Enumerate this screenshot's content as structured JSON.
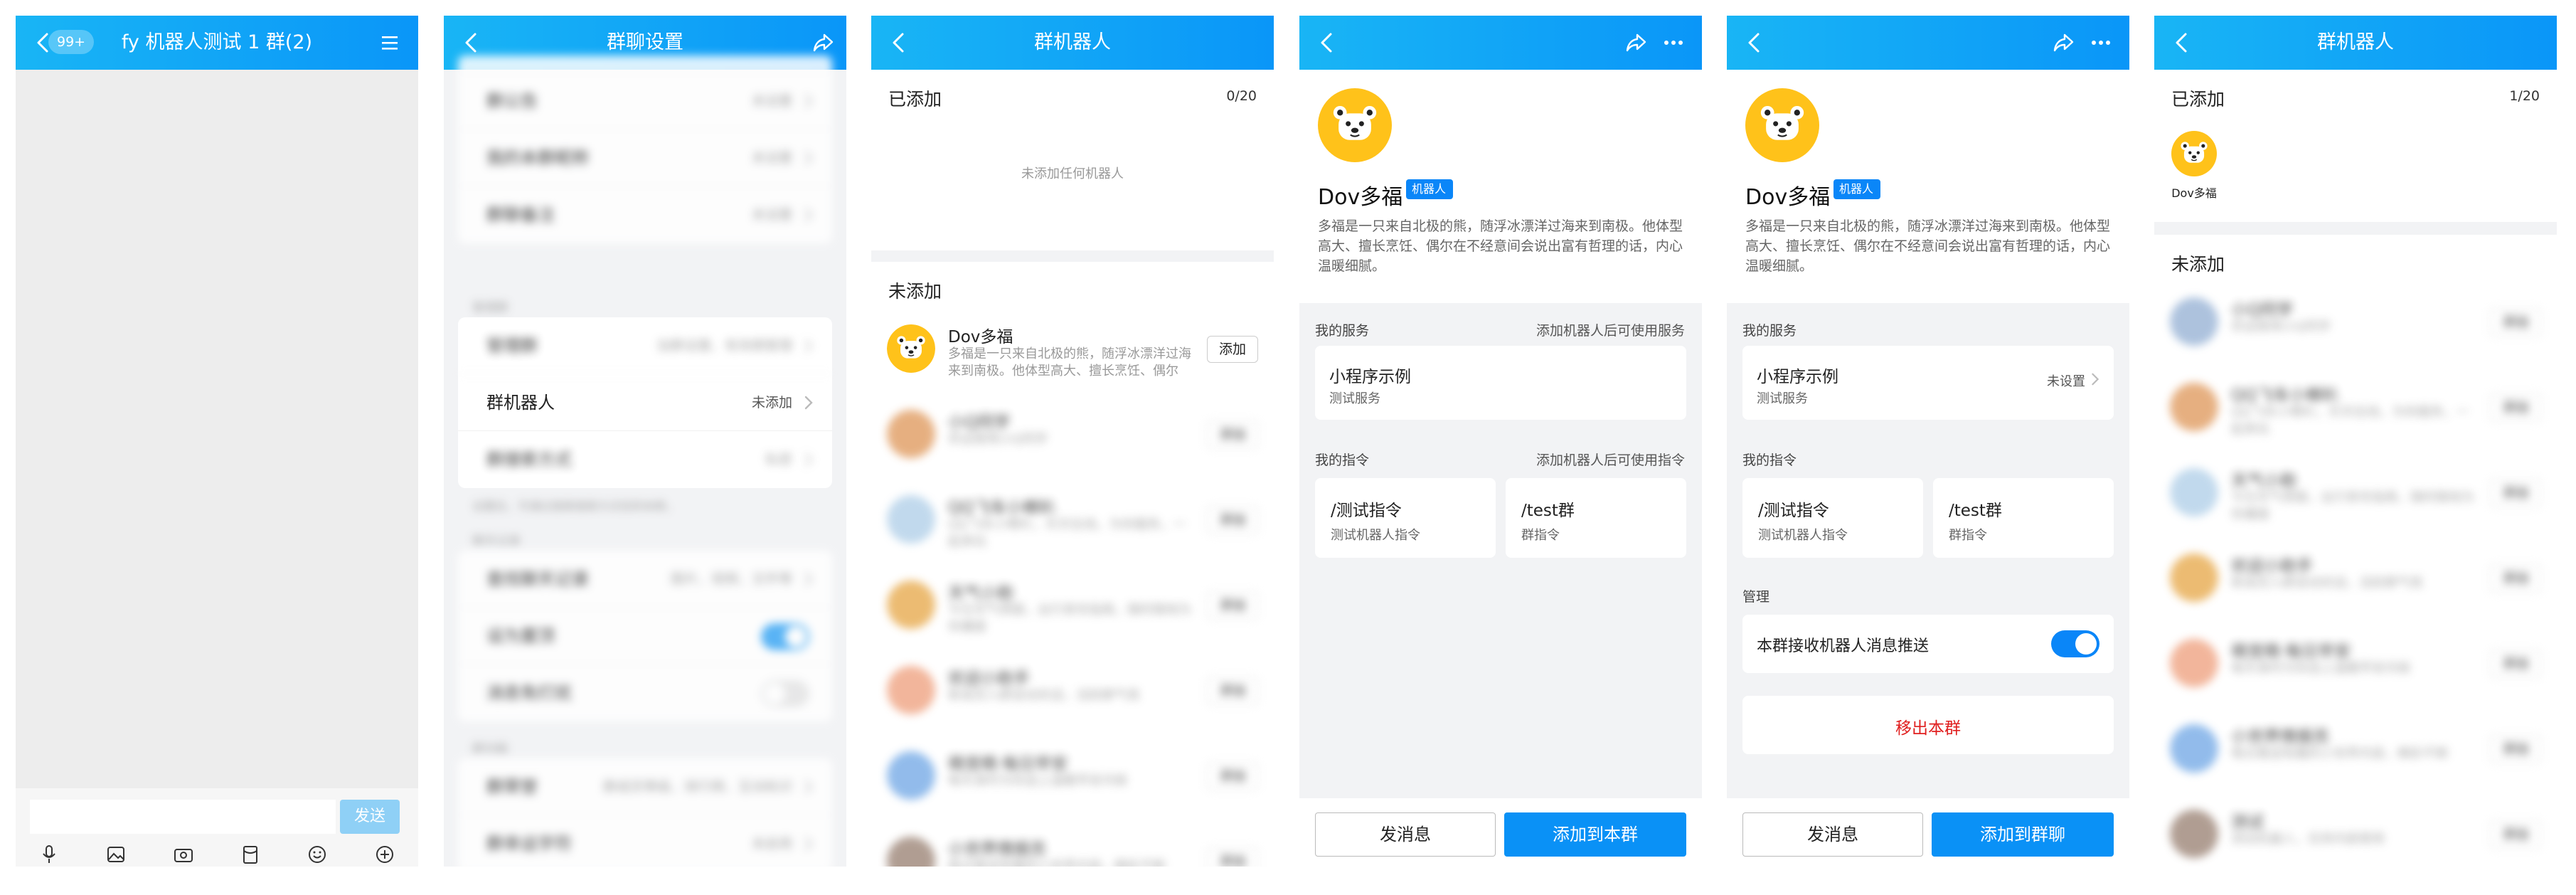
{
  "colors": {
    "nav_gradient_start": "#19b5f5",
    "nav_gradient_end": "#0a96f8",
    "primary": "#0a91f6",
    "danger": "#e02020",
    "toggle_on": "#3fa9f5"
  },
  "screen1": {
    "title": "fy 机器人测试 1 群(2)",
    "unread_badge": "99+",
    "send_label": "发送",
    "toolbar_icons": [
      "microphone-icon",
      "image-icon",
      "camera-icon",
      "red-packet-icon",
      "emoji-icon",
      "plus-icon"
    ]
  },
  "screen2": {
    "title": "群聊设置",
    "rows_top": [
      {
        "label": "群公告",
        "value": "未设置"
      },
      {
        "label": "我的本群昵称",
        "value": "未设置"
      },
      {
        "label": "群聊备注",
        "value": "未设置"
      }
    ],
    "section_manage": "管理群",
    "rows_manage": [
      {
        "label": "管理群",
        "value": "加群设置、有效期管理"
      },
      {
        "label": "群机器人",
        "value": "未添加"
      },
      {
        "label": "群搜索方式",
        "value": "私密"
      }
    ],
    "manage_hint": "设置后，可通过搜索搜索方式找到本群。",
    "section_chat": "聊天记录",
    "rows_chat": [
      {
        "label": "查找聊天记录",
        "value": "图片、视频、文件等"
      },
      {
        "label": "设为置顶",
        "toggle": true
      },
      {
        "label": "消息免打扰",
        "toggle": false
      }
    ],
    "section_more": "群功能",
    "rows_more": [
      {
        "label": "群荣誉",
        "value": "群成员等级、排行榜、互动标识"
      },
      {
        "label": "群幸运字符",
        "value": "未启用"
      }
    ]
  },
  "screen3": {
    "title": "群机器人",
    "added_title": "已添加",
    "added_count": "0/20",
    "empty_text": "未添加任何机器人",
    "not_added_title": "未添加",
    "bots": [
      {
        "name": "Dov多福",
        "desc": "多福是一只来自北极的熊，随浮冰漂洋过海来到南极。他体型高大、擅长烹饪、偶尔会…",
        "add_label": "添加",
        "blur": false
      },
      {
        "name": "小Q同学",
        "desc": "欢迎使用小Q同学",
        "add_label": "添加",
        "blur": true
      },
      {
        "name": "QQ飞车小喇叭",
        "desc": "QQ飞车小喇叭，天天在线，为你服务，一起来玩",
        "add_label": "添加",
        "blur": true
      },
      {
        "name": "天气小助",
        "desc": "今日天气预报，出行穿衣指南，随时随地为你播报",
        "add_label": "添加",
        "blur": true
      },
      {
        "name": "欢迎小助手",
        "desc": "新成员入群自动欢迎，活跃群气氛",
        "add_label": "添加",
        "blur": true
      },
      {
        "name": "萌宠萌·每日早安",
        "desc": "每天准时为你送上温暖早安问候",
        "add_label": "添加",
        "blur": true
      },
      {
        "name": "小世界情报员",
        "desc": "每日推送有趣的小世界内容，精彩不断",
        "add_label": "添加",
        "blur": true
      }
    ]
  },
  "profile": {
    "bot_name": "Dov多福",
    "bot_tag": "机器人",
    "bot_desc": "多福是一只来自北极的熊，随浮冰漂洋过海来到南极。他体型高大、擅长烹饪、偶尔在不经意间会说出富有哲理的话，内心温暖细腻。",
    "services_head": "我的服务",
    "services_hint": "添加机器人后可使用服务",
    "service_title": "小程序示例",
    "service_sub": "测试服务",
    "service_value": "未设置",
    "commands_head": "我的指令",
    "commands_hint": "添加机器人后可使用指令",
    "commands": [
      {
        "title": "/测试指令",
        "sub": "测试机器人指令"
      },
      {
        "title": "/test群",
        "sub": "群指令"
      }
    ],
    "manage_head": "管理",
    "push_label": "本群接收机器人消息推送",
    "remove_label": "移出本群",
    "send_msg_label": "发消息",
    "add_to_group_label": "添加到本群",
    "add_to_chat_label": "添加到群聊"
  },
  "screen6": {
    "title": "群机器人",
    "added_title": "已添加",
    "added_count": "1/20",
    "added_bot_name": "Dov多福",
    "not_added_title": "未添加",
    "bots": [
      {
        "name": "小Q同学",
        "desc": "欢迎使用小Q同学",
        "add_label": "添加"
      },
      {
        "name": "QQ飞车小喇叭",
        "desc": "QQ飞车小喇叭，天天在线，为你服务，一起来玩",
        "add_label": "添加"
      },
      {
        "name": "天气小助",
        "desc": "今日天气预报，出行穿衣指南，随时随地为你播报",
        "add_label": "添加"
      },
      {
        "name": "欢迎小助手",
        "desc": "新成员入群自动欢迎，活跃群气氛",
        "add_label": "添加"
      },
      {
        "name": "萌宠萌·每日早安",
        "desc": "每天准时为你送上温暖早安问候",
        "add_label": "添加"
      },
      {
        "name": "小世界情报员",
        "desc": "每日推送有趣的小世界内容，精彩不断",
        "add_label": "添加"
      },
      {
        "name": "测试",
        "desc": "测试机器人，仅供内部使用",
        "add_label": "添加"
      }
    ]
  }
}
